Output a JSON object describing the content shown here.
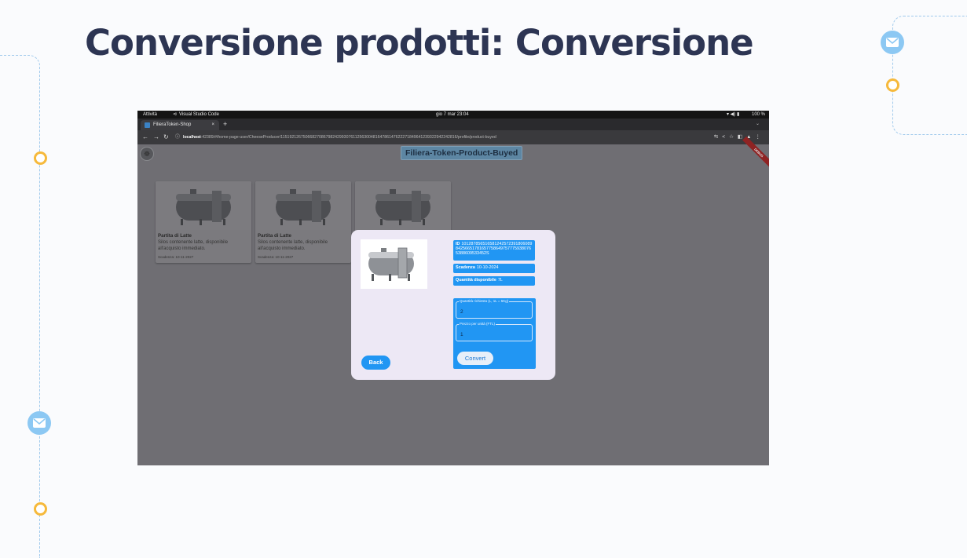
{
  "slide": {
    "title": "Conversione prodotti: Conversione",
    "colors": {
      "title": "#2d3553",
      "decoration_line": "#9fc9ec",
      "decoration_dot": "#f6b93b",
      "mail_icon_bg": "#8cc8f3"
    }
  },
  "os_bar": {
    "activities": "Attività",
    "app_name": "Visual Studio Code",
    "clock": "gio 7 mar  23:04",
    "battery": "100 %"
  },
  "browser": {
    "tab_title": "FilieraToken-Shop",
    "tab_close": "×",
    "new_tab": "+",
    "url_host": "localhost",
    "url_path": ":42389/#/home-page-user/CheeseProducer/115192126750668270867982429930761125630048164786147622271849641239322942242816/profile/product-buyed"
  },
  "app": {
    "title": "Filiera-Token-Product-Buyed",
    "debug_banner": "DEBUG",
    "colors": {
      "primary": "#2196f3",
      "dialog_bg": "#ede8f5",
      "overlay": "#6f6e73"
    },
    "cards": [
      {
        "name": "Partita di Latte",
        "description": "Silos contenente latte, disponibile all'acquisto immediato.",
        "expiry": "Scadenza: 10-11-2027"
      },
      {
        "name": "Partita di Latte",
        "description": "Silos contenente latte, disponibile all'acquisto immediato.",
        "expiry": "Scadenza: 10-11-2027"
      },
      {
        "name": "",
        "description": "",
        "expiry": ""
      }
    ]
  },
  "dialog": {
    "id_label": "ID",
    "id_value": "101287856516581242572391806089842566517816577586497577759380765388609533452S",
    "expiry_label": "Scadenza",
    "expiry_value": "10-10-2024",
    "available_label": "Quantità disponibile",
    "available_value": "7L",
    "quantity_field": {
      "label": "Quantità richiesta  (L, 1L = 5Kg)",
      "value": "2"
    },
    "price_field": {
      "label": "Prezzo per unità (FTL)",
      "value": "1"
    },
    "convert_label": "Convert",
    "back_label": "Back"
  }
}
